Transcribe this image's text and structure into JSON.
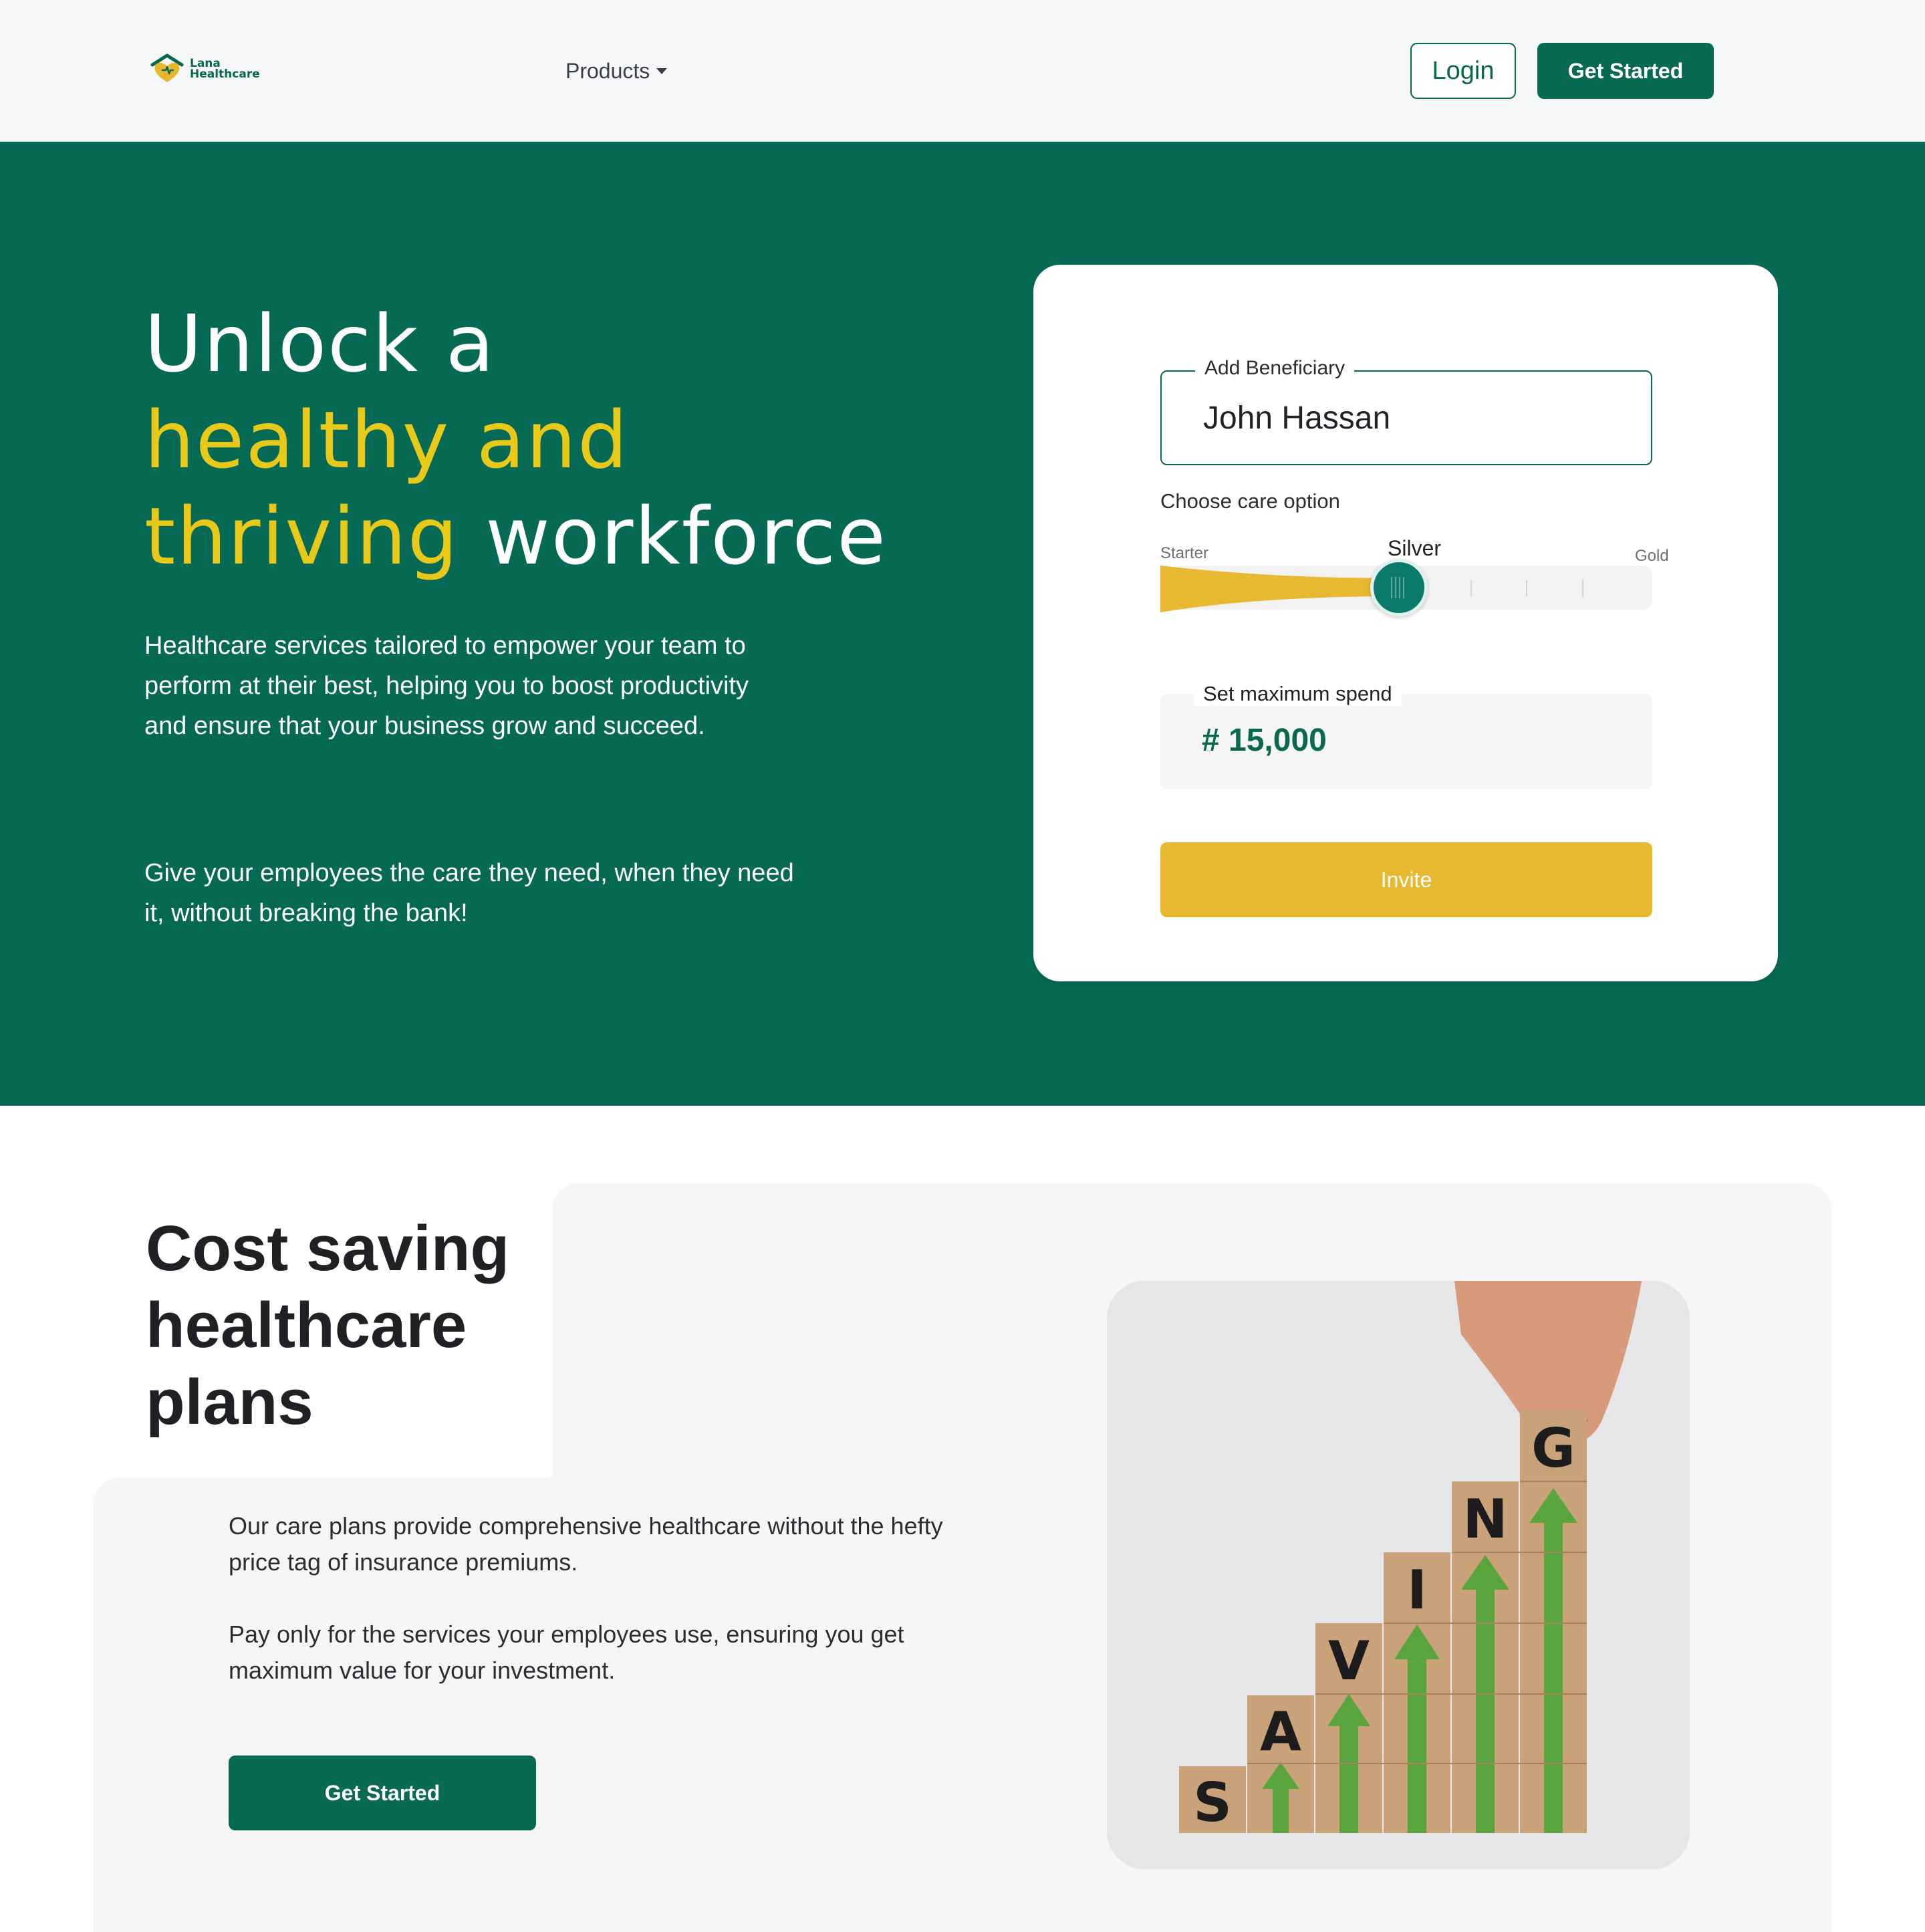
{
  "navbar": {
    "brand_line1": "Lana",
    "brand_line2": "Healthcare",
    "products_label": "Products",
    "login_label": "Login",
    "get_started_label": "Get Started"
  },
  "hero": {
    "title_part1": "Unlock a",
    "title_part2": "healthy and",
    "title_part3": "thriving",
    "title_part4": "workforce",
    "paragraph1": "Healthcare services tailored to empower your team to perform at their best, helping you to boost productivity and ensure that your business grow and succeed.",
    "paragraph2": "Give your employees the care they need, when they need it, without breaking the bank!",
    "accent_color": "#e8c91a",
    "background_color": "#066953"
  },
  "card": {
    "beneficiary_label": "Add Beneficiary",
    "beneficiary_value": "John Hassan",
    "care_option_label": "Choose care option",
    "care_options": [
      "Starter",
      "Silver",
      "Gold"
    ],
    "care_option_selected": "Silver",
    "spend_label": "Set maximum spend",
    "spend_value": "# 15,000",
    "invite_label": "Invite",
    "invite_color": "#e8b830"
  },
  "cost_section": {
    "title": "Cost saving healthcare plans",
    "paragraph1": "Our care plans provide comprehensive healthcare without the hefty price tag of insurance premiums.",
    "paragraph2": "Pay only for the services your employees use, ensuring you get maximum value for your investment.",
    "cta_label": "Get Started",
    "image_letters": [
      "S",
      "A",
      "V",
      "I",
      "N",
      "G"
    ]
  }
}
